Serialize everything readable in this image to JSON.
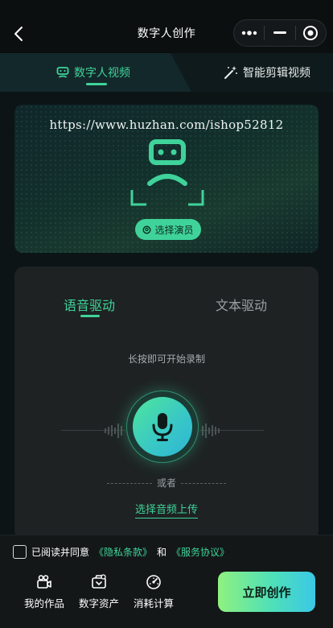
{
  "nav": {
    "title": "数字人创作"
  },
  "tabs": [
    {
      "label": "数字人视频",
      "active": true
    },
    {
      "label": "智能剪辑视频",
      "active": false
    }
  ],
  "hero": {
    "watermark": "https://www.huzhan.com/ishop52812",
    "select_actor_label": "选择演员"
  },
  "drive_tabs": [
    {
      "label": "语音驱动",
      "active": true
    },
    {
      "label": "文本驱动",
      "active": false
    }
  ],
  "record": {
    "hint": "长按即可开始录制",
    "or_label": "或者",
    "upload_label": "选择音频上传"
  },
  "agreement": {
    "prefix": "已阅读并同意",
    "privacy": "《隐私条款》",
    "and": "和",
    "service": "《服务协议》",
    "checked": false
  },
  "bottom_nav": [
    {
      "label": "我的作品",
      "icon": "camera-icon"
    },
    {
      "label": "数字资产",
      "icon": "asset-icon"
    },
    {
      "label": "消耗计算",
      "icon": "gauge-icon"
    }
  ],
  "create_button": "立即创作",
  "colors": {
    "accent": "#3fd39a",
    "background": "#0c1416",
    "card": "#1e2223"
  }
}
